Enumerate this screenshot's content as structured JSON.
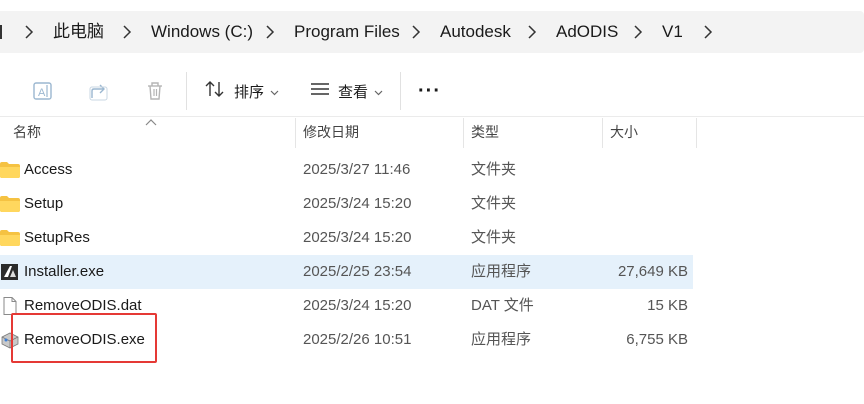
{
  "breadcrumb": [
    "此电脑",
    "Windows (C:)",
    "Program Files",
    "Autodesk",
    "AdODIS",
    "V1"
  ],
  "toolbar": {
    "sort_label": "排序",
    "view_label": "查看",
    "more_label": "···"
  },
  "columns": {
    "name": "名称",
    "date": "修改日期",
    "type": "类型",
    "size": "大小"
  },
  "files": [
    {
      "name": "Access",
      "date": "2025/3/27 11:46",
      "type": "文件夹",
      "size": "",
      "icon": "folder-icon"
    },
    {
      "name": "Setup",
      "date": "2025/3/24 15:20",
      "type": "文件夹",
      "size": "",
      "icon": "folder-icon"
    },
    {
      "name": "SetupRes",
      "date": "2025/3/24 15:20",
      "type": "文件夹",
      "size": "",
      "icon": "folder-icon"
    },
    {
      "name": "Installer.exe",
      "date": "2025/2/25 23:54",
      "type": "应用程序",
      "size": "27,649 KB",
      "icon": "app-exe-icon",
      "selected": true
    },
    {
      "name": "RemoveODIS.dat",
      "date": "2025/3/24 15:20",
      "type": "DAT 文件",
      "size": "15 KB",
      "icon": "document-icon"
    },
    {
      "name": "RemoveODIS.exe",
      "date": "2025/2/26 10:51",
      "type": "应用程序",
      "size": "6,755 KB",
      "icon": "setup-exe-icon",
      "highlighted": true
    }
  ],
  "colors": {
    "selected_row": "#e5f1fb",
    "highlight_box": "#e53935",
    "folder": "#f5c242"
  }
}
